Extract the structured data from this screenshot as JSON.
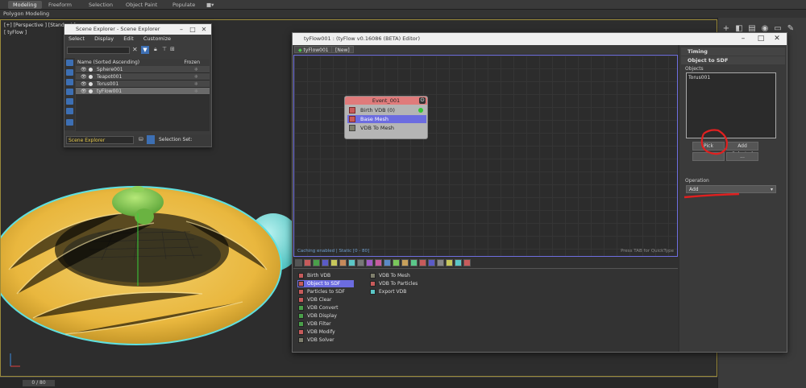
{
  "ribbon": {
    "tabs": [
      "Modeling",
      "Freeform",
      "Selection",
      "Object Paint",
      "Populate"
    ],
    "sub_label": "Polygon Modeling"
  },
  "viewport": {
    "label": "[+] [Perspective ] [Standard ]",
    "sub_label": "[ tyFlow ]"
  },
  "timeline": {
    "frame": "0 / 80"
  },
  "scene_explorer": {
    "title": "Scene Explorer - Scene Explorer",
    "menu": [
      "Select",
      "Display",
      "Edit",
      "Customize"
    ],
    "col_name": "Name (Sorted Ascending)",
    "col_frozen": "Frozen",
    "rows": [
      "Sphere001",
      "Teapot001",
      "Torus001",
      "tyFlow001"
    ],
    "selected_row": "tyFlow001",
    "dropdown": "Scene Explorer",
    "selection_set": "Selection Set:"
  },
  "tyflow": {
    "title": "tyFlow001 : (tyFlow v0.16086 (BETA) Editor)",
    "tabs": [
      "tyFlow001",
      "[New]"
    ],
    "status": "Caching enabled | Static [0 - 80]",
    "quicktype": "Press TAB for QuickType",
    "event": {
      "title": "Event_001",
      "ops": [
        "Birth VDB (0)",
        "Base Mesh",
        "VDB To Mesh"
      ],
      "selected": "Base Mesh"
    },
    "operators_col1": [
      "Birth VDB",
      "Object to SDF",
      "Particles to SDF",
      "VDB Clear",
      "VDB Convert",
      "VDB Display",
      "VDB Filter",
      "VDB Modify",
      "VDB Solver"
    ],
    "operators_col2": [
      "VDB To Mesh",
      "VDB To Particles",
      "Export VDB"
    ],
    "selected_operator": "Object to SDF",
    "panel": {
      "timing": "Timing",
      "section": "Object to SDF",
      "objects_label": "Objects",
      "objects": [
        "Torus001"
      ],
      "pick": "Pick",
      "add_selected": "Add Selected",
      "ellipsis": "...",
      "operation_label": "Operation",
      "operation_value": "Add"
    }
  },
  "colors": {
    "accent": "#6c6ce0",
    "event_header": "#e07b7b",
    "annotation": "#e02020"
  }
}
